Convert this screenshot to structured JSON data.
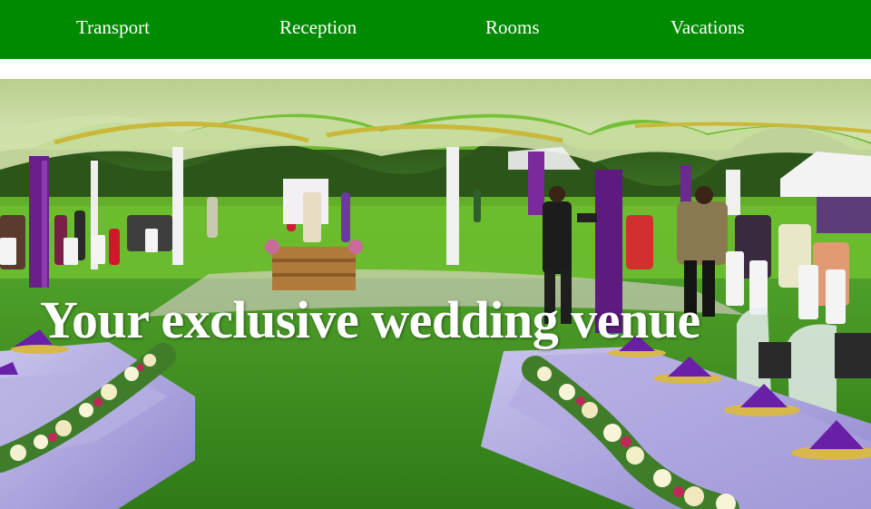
{
  "nav": {
    "items": [
      {
        "label": "Transport"
      },
      {
        "label": "Reception"
      },
      {
        "label": "Rooms"
      },
      {
        "label": "Vacations"
      }
    ],
    "background_color": "#008a00",
    "text_color": "#ffffff"
  },
  "hero": {
    "title": "Your exclusive wedding venue",
    "image_subject": "outdoor wedding reception under white tents with purple drapes and floral tables on a lawn"
  }
}
